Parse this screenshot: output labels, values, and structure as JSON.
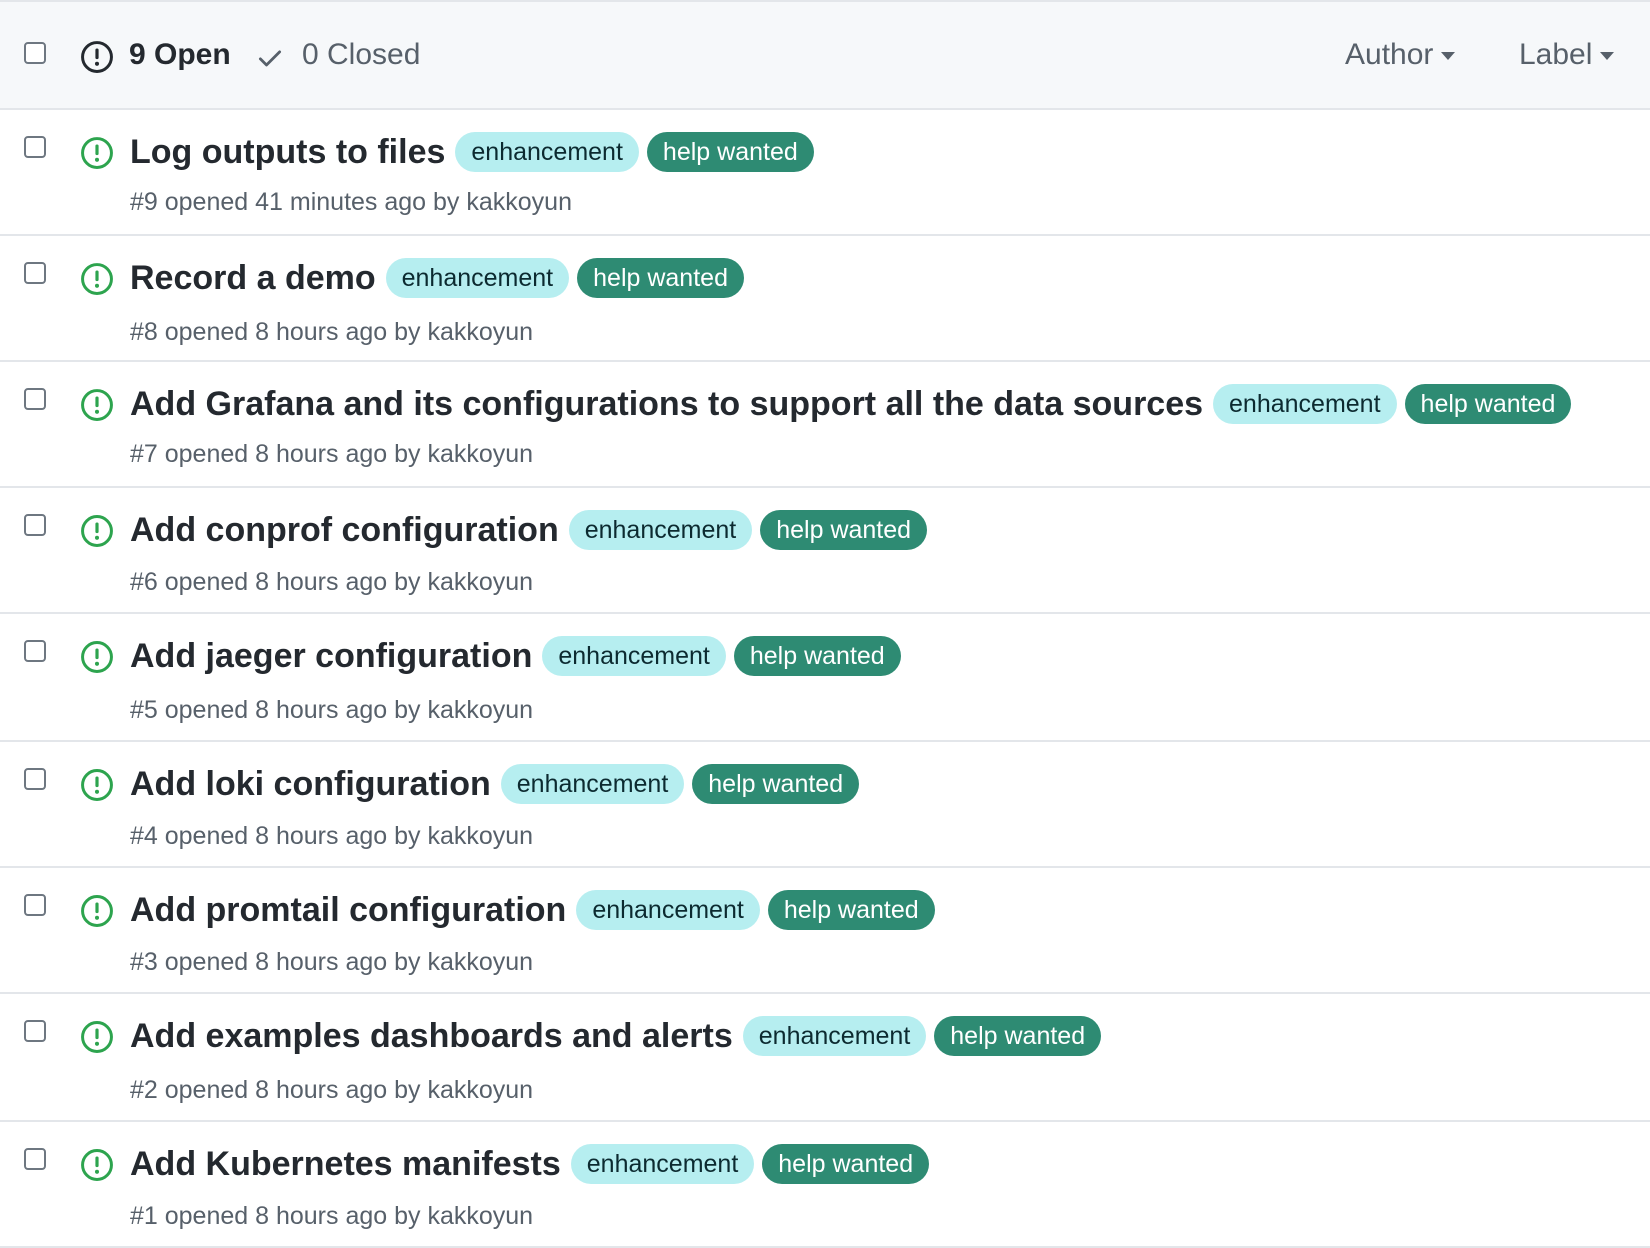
{
  "header": {
    "open_label": "9 Open",
    "closed_label": "0 Closed",
    "filters": {
      "author": "Author",
      "label": "Label"
    }
  },
  "labels": {
    "enhancement": "enhancement",
    "help_wanted": "help wanted"
  },
  "colors": {
    "open_icon": "#2da44e",
    "enhancement_bg": "#b6eef0",
    "help_wanted_bg": "#2e8b73",
    "header_bg": "#f6f8fa",
    "border": "#e3e6ea"
  },
  "icons": {
    "header_open": "issue-opened-icon",
    "closed": "check-icon",
    "row": "issue-opened-icon"
  },
  "issues": [
    {
      "title": "Log outputs to files",
      "meta": "#9 opened 41 minutes ago by kakkoyun"
    },
    {
      "title": "Record a demo",
      "meta": "#8 opened 8 hours ago by kakkoyun"
    },
    {
      "title": "Add Grafana and its configurations to support all the data sources",
      "meta": "#7 opened 8 hours ago by kakkoyun"
    },
    {
      "title": "Add conprof configuration",
      "meta": "#6 opened 8 hours ago by kakkoyun"
    },
    {
      "title": "Add jaeger configuration",
      "meta": "#5 opened 8 hours ago by kakkoyun"
    },
    {
      "title": "Add loki configuration",
      "meta": "#4 opened 8 hours ago by kakkoyun"
    },
    {
      "title": "Add promtail configuration",
      "meta": "#3 opened 8 hours ago by kakkoyun"
    },
    {
      "title": "Add examples dashboards and alerts",
      "meta": "#2 opened 8 hours ago by kakkoyun"
    },
    {
      "title": "Add Kubernetes manifests",
      "meta": "#1 opened 8 hours ago by kakkoyun"
    }
  ]
}
